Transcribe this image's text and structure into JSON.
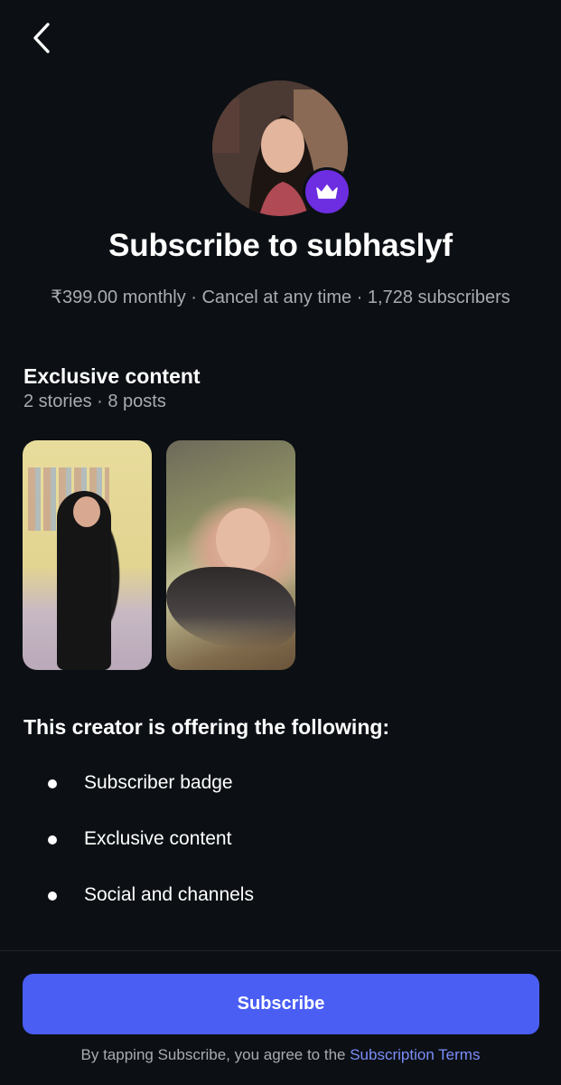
{
  "header": {
    "back_icon": "chevron-left-icon"
  },
  "profile": {
    "badge_icon": "crown-icon",
    "badge_color": "#6c2ee0"
  },
  "title": "Subscribe to subhaslyf",
  "meta": "₹399.00 monthly · Cancel at any time · 1,728 subscribers",
  "exclusive": {
    "title": "Exclusive content",
    "subtitle": "2 stories · 8 posts"
  },
  "offering": {
    "title": "This creator is offering the following:",
    "items": [
      "Subscriber badge",
      "Exclusive content",
      "Social and channels"
    ]
  },
  "footer": {
    "subscribe_label": "Subscribe",
    "terms_text": "By tapping Subscribe, you agree to the ",
    "terms_link": "Subscription Terms",
    "accent_color": "#4a5ef4",
    "link_color": "#7b8dfa"
  }
}
